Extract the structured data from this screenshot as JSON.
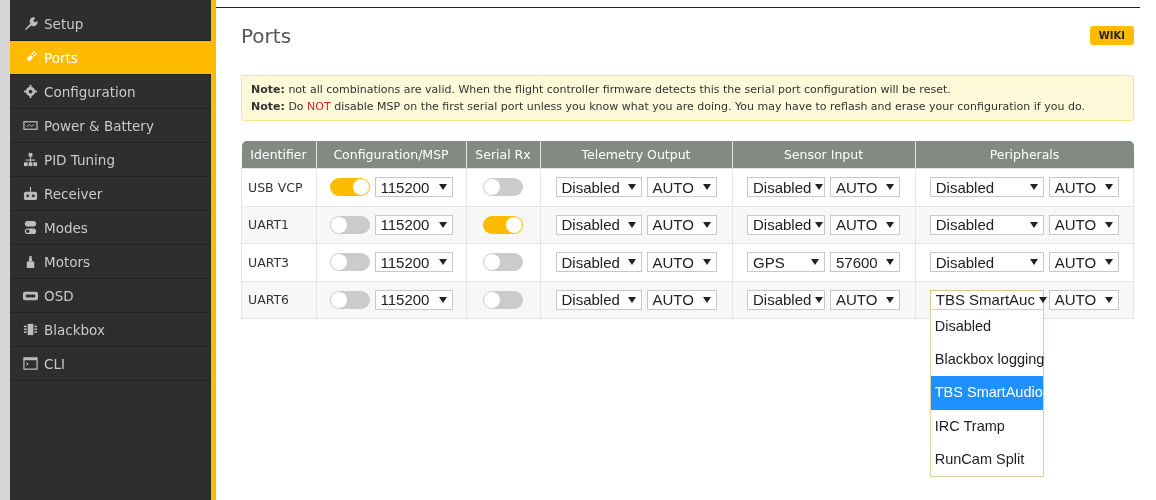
{
  "sidebar": {
    "items": [
      {
        "label": "Setup",
        "selected": false
      },
      {
        "label": "Ports",
        "selected": true
      },
      {
        "label": "Configuration",
        "selected": false
      },
      {
        "label": "Power & Battery",
        "selected": false
      },
      {
        "label": "PID Tuning",
        "selected": false
      },
      {
        "label": "Receiver",
        "selected": false
      },
      {
        "label": "Modes",
        "selected": false
      },
      {
        "label": "Motors",
        "selected": false
      },
      {
        "label": "OSD",
        "selected": false
      },
      {
        "label": "Blackbox",
        "selected": false
      },
      {
        "label": "CLI",
        "selected": false
      }
    ]
  },
  "page": {
    "title": "Ports",
    "wiki_button": "WIKI"
  },
  "notes": [
    {
      "label": "Note:",
      "before": "not all combinations are valid. When the flight controller firmware detects this the serial port configuration will be reset."
    },
    {
      "label": "Note:",
      "before": "Do",
      "warning": "NOT",
      "after": "disable MSP on the first serial port unless you know what you are doing. You may have to reflash and erase your configuration if you do."
    }
  ],
  "table": {
    "columns": [
      "Identifier",
      "Configuration/MSP",
      "Serial Rx",
      "Telemetry Output",
      "Sensor Input",
      "Peripherals"
    ],
    "rows": [
      {
        "identifier": "USB VCP",
        "msp": true,
        "msp_baud": "115200",
        "serial_rx": false,
        "telemetry": "Disabled",
        "telemetry_baud": "AUTO",
        "sensor": "Disabled",
        "sensor_baud": "AUTO",
        "peripheral": "Disabled",
        "peripheral_baud": "AUTO"
      },
      {
        "identifier": "UART1",
        "msp": false,
        "msp_baud": "115200",
        "serial_rx": true,
        "telemetry": "Disabled",
        "telemetry_baud": "AUTO",
        "sensor": "Disabled",
        "sensor_baud": "AUTO",
        "peripheral": "Disabled",
        "peripheral_baud": "AUTO"
      },
      {
        "identifier": "UART3",
        "msp": false,
        "msp_baud": "115200",
        "serial_rx": false,
        "telemetry": "Disabled",
        "telemetry_baud": "AUTO",
        "sensor": "GPS",
        "sensor_baud": "57600",
        "peripheral": "Disabled",
        "peripheral_baud": "AUTO"
      },
      {
        "identifier": "UART6",
        "msp": false,
        "msp_baud": "115200",
        "serial_rx": false,
        "telemetry": "Disabled",
        "telemetry_baud": "AUTO",
        "sensor": "Disabled",
        "sensor_baud": "AUTO",
        "peripheral": "TBS SmartAuc",
        "peripheral_baud": "AUTO",
        "peripheral_expanded": true,
        "peripheral_options": [
          {
            "label": "Disabled",
            "selected": false
          },
          {
            "label": "Blackbox logging",
            "selected": false
          },
          {
            "label": "TBS SmartAudio",
            "selected": true
          },
          {
            "label": "IRC Tramp",
            "selected": false
          },
          {
            "label": "RunCam Split",
            "selected": false
          }
        ]
      }
    ]
  }
}
